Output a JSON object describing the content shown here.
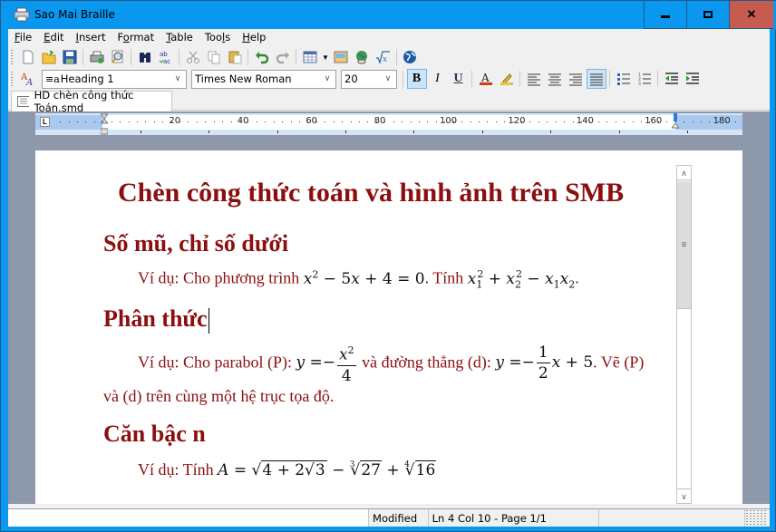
{
  "window": {
    "title": "Sao Mai Braille",
    "controls": {
      "minimize": "–",
      "maximize": "□",
      "close": "✕"
    }
  },
  "menubar": {
    "items": [
      {
        "label": "File",
        "mnemonic": "F"
      },
      {
        "label": "Edit",
        "mnemonic": "E"
      },
      {
        "label": "Insert",
        "mnemonic": "I"
      },
      {
        "label": "Format",
        "mnemonic": "o"
      },
      {
        "label": "Table",
        "mnemonic": "T"
      },
      {
        "label": "Tools",
        "mnemonic": "l"
      },
      {
        "label": "Help",
        "mnemonic": "H"
      }
    ]
  },
  "toolbar1": {
    "buttons": [
      "new-document",
      "open-folder",
      "save",
      "print",
      "print-preview",
      "find",
      "spell-check",
      "cut",
      "copy",
      "paste",
      "undo",
      "redo",
      "insert-table",
      "insert-image",
      "insert-link",
      "insert-math",
      "web"
    ]
  },
  "toolbar2": {
    "style_value": "Heading 1",
    "font_value": "Times New Roman",
    "size_value": "20",
    "bold_active": true,
    "justify_active": true
  },
  "tabs": [
    {
      "label": "HD chèn công thức Toán.smd",
      "active": true
    }
  ],
  "ruler": {
    "labels": [
      "20",
      "40",
      "60",
      "80",
      "100",
      "120",
      "140",
      "160",
      "180"
    ],
    "tab_marker": "L"
  },
  "document": {
    "title": "Chèn công thức toán và hình ảnh trên SMB",
    "sections": [
      {
        "heading": "Số mũ, chỉ số dưới",
        "para_prefix": "Ví dụ: Cho phương trình ",
        "para_mid": ". Tính ",
        "para_suffix": "."
      },
      {
        "heading": "Phân thức",
        "para_prefix": "Ví dụ: Cho parabol (P): ",
        "para_mid": " và đường thẳng (d): ",
        "para_suffix": ". Vẽ (P)",
        "para_line2": "và (d) trên cùng một hệ trục tọa độ."
      },
      {
        "heading": "Căn bậc n",
        "para_prefix": "Ví dụ: Tính "
      }
    ],
    "math": {
      "eq1_a": "x",
      "eq1_exp": "2",
      "eq1_b": " − 5",
      "eq1_c": "x",
      "eq1_d": " + 4 = 0",
      "eq2": "x₁² + x₂² − x₁x₂",
      "parabol_lhs": "y",
      "parabol_eq": " =−",
      "parabol_num": "x²",
      "parabol_den": "4",
      "line_lhs": "y",
      "line_eq": " =−",
      "line_num": "1",
      "line_den": "2",
      "line_rest": "x + 5",
      "root_lhs": "A",
      "root_eq": " = ",
      "root1": "4 + 2√3",
      "root_minus": " − ",
      "root2_idx": "3",
      "root2": "27",
      "root_plus": " + ",
      "root3_idx": "4",
      "root3": "16"
    }
  },
  "statusbar": {
    "modified": "Modified",
    "position": "Ln 4 Col 10 - Page 1/1"
  },
  "colors": {
    "titlebar": "#0a97f0",
    "close_button": "#c75b50",
    "heading_text": "#8b0f0f",
    "editor_bg": "#8d98aa"
  }
}
